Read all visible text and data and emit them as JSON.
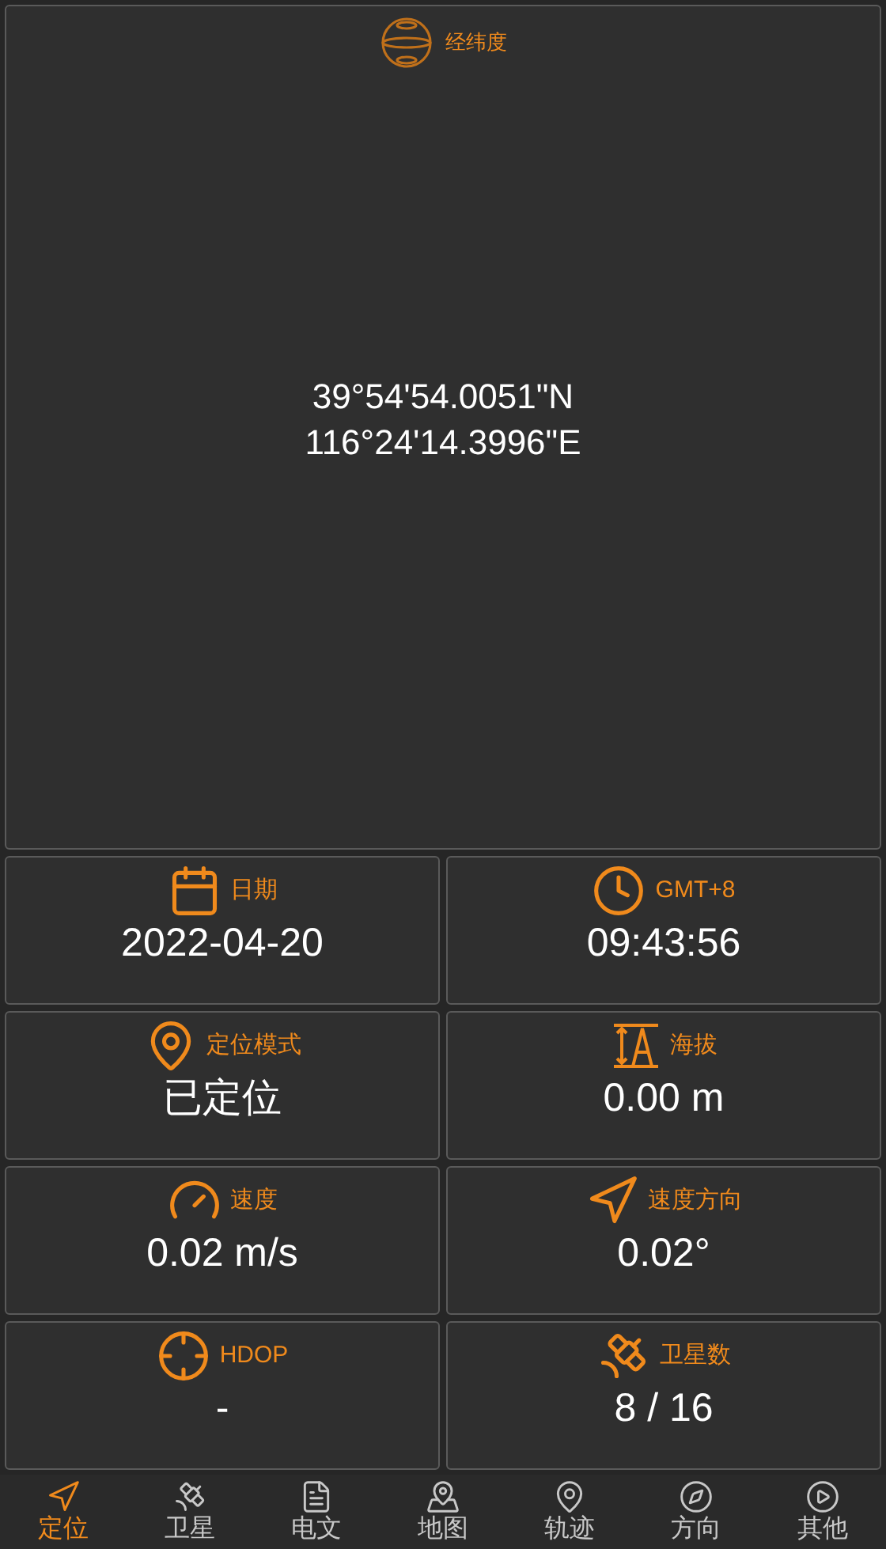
{
  "coordinates": {
    "title": "经纬度",
    "latitude": "39°54'54.0051\"N",
    "longitude": "116°24'14.3996\"E"
  },
  "cards": [
    {
      "label": "日期",
      "value": "2022-04-20"
    },
    {
      "label": "GMT+8",
      "value": "09:43:56"
    },
    {
      "label": "定位模式",
      "value": "已定位"
    },
    {
      "label": "海拔",
      "value": "0.00 m"
    },
    {
      "label": "速度",
      "value": "0.02 m/s"
    },
    {
      "label": "速度方向",
      "value": "0.02°"
    },
    {
      "label": "HDOP",
      "value": "-"
    },
    {
      "label": "卫星数",
      "value": "8 / 16"
    }
  ],
  "tabs": [
    {
      "label": "定位",
      "selected": true
    },
    {
      "label": "卫星",
      "selected": false
    },
    {
      "label": "电文",
      "selected": false
    },
    {
      "label": "地图",
      "selected": false
    },
    {
      "label": "轨迹",
      "selected": false
    },
    {
      "label": "方向",
      "selected": false
    },
    {
      "label": "其他",
      "selected": false
    }
  ]
}
